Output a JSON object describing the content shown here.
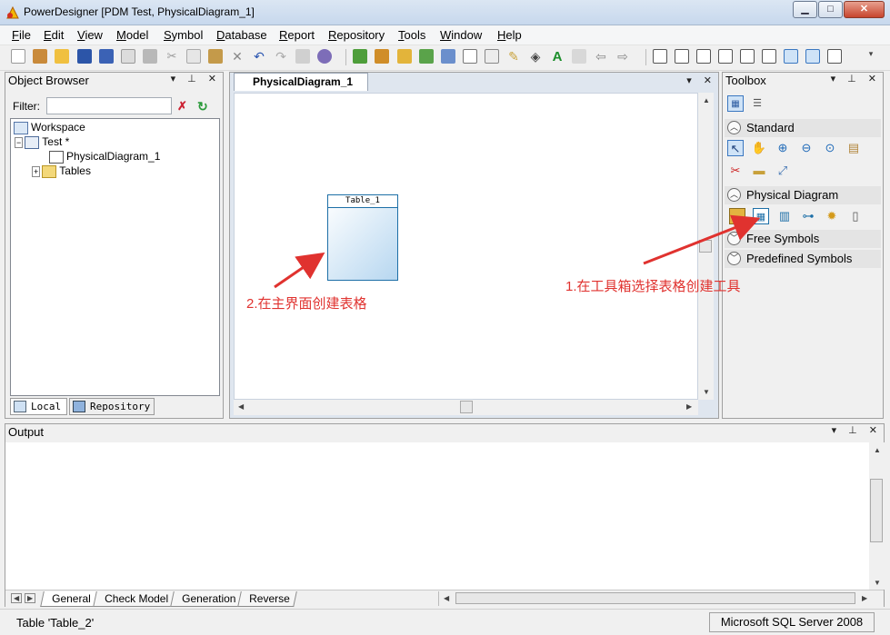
{
  "window": {
    "title": "PowerDesigner [PDM Test, PhysicalDiagram_1]"
  },
  "menu": [
    {
      "label": "File",
      "ul": "F",
      "rest": "ile"
    },
    {
      "label": "Edit",
      "ul": "E",
      "rest": "dit"
    },
    {
      "label": "View",
      "ul": "V",
      "rest": "iew"
    },
    {
      "label": "Model",
      "ul": "M",
      "rest": "odel"
    },
    {
      "label": "Symbol",
      "ul": "S",
      "rest": "ymbol"
    },
    {
      "label": "Database",
      "ul": "D",
      "rest": "atabase"
    },
    {
      "label": "Report",
      "ul": "R",
      "rest": "eport"
    },
    {
      "label": "Repository",
      "ul": "R",
      "rest": "epository"
    },
    {
      "label": "Tools",
      "ul": "T",
      "rest": "ools"
    },
    {
      "label": "Window",
      "ul": "W",
      "rest": "indow"
    },
    {
      "label": "Help",
      "ul": "H",
      "rest": "elp"
    }
  ],
  "object_browser": {
    "title": "Object Browser",
    "filter_label": "Filter:",
    "filter_value": "",
    "tree": {
      "workspace": "Workspace",
      "model": "Test *",
      "diagram": "PhysicalDiagram_1",
      "tables": "Tables"
    },
    "tabs": {
      "local": "Local",
      "repository": "Repository"
    }
  },
  "diagram": {
    "tab_label": "PhysicalDiagram_1",
    "table_name": "Table_1"
  },
  "toolbox": {
    "title": "Toolbox",
    "groups": {
      "standard": "Standard",
      "physical": "Physical Diagram",
      "free": "Free Symbols",
      "predefined": "Predefined Symbols"
    }
  },
  "output": {
    "title": "Output",
    "tabs": {
      "general": "General",
      "check": "Check Model",
      "generation": "Generation",
      "reverse": "Reverse"
    }
  },
  "status": {
    "message": "Table 'Table_2'",
    "dbms": "Microsoft SQL Server 2008"
  },
  "annotations": {
    "step1": "1.在工具箱选择表格创建工具",
    "step2": "2.在主界面创建表格"
  },
  "colors": {
    "annotation": "#e0322f",
    "table_border": "#1d6fa7"
  }
}
